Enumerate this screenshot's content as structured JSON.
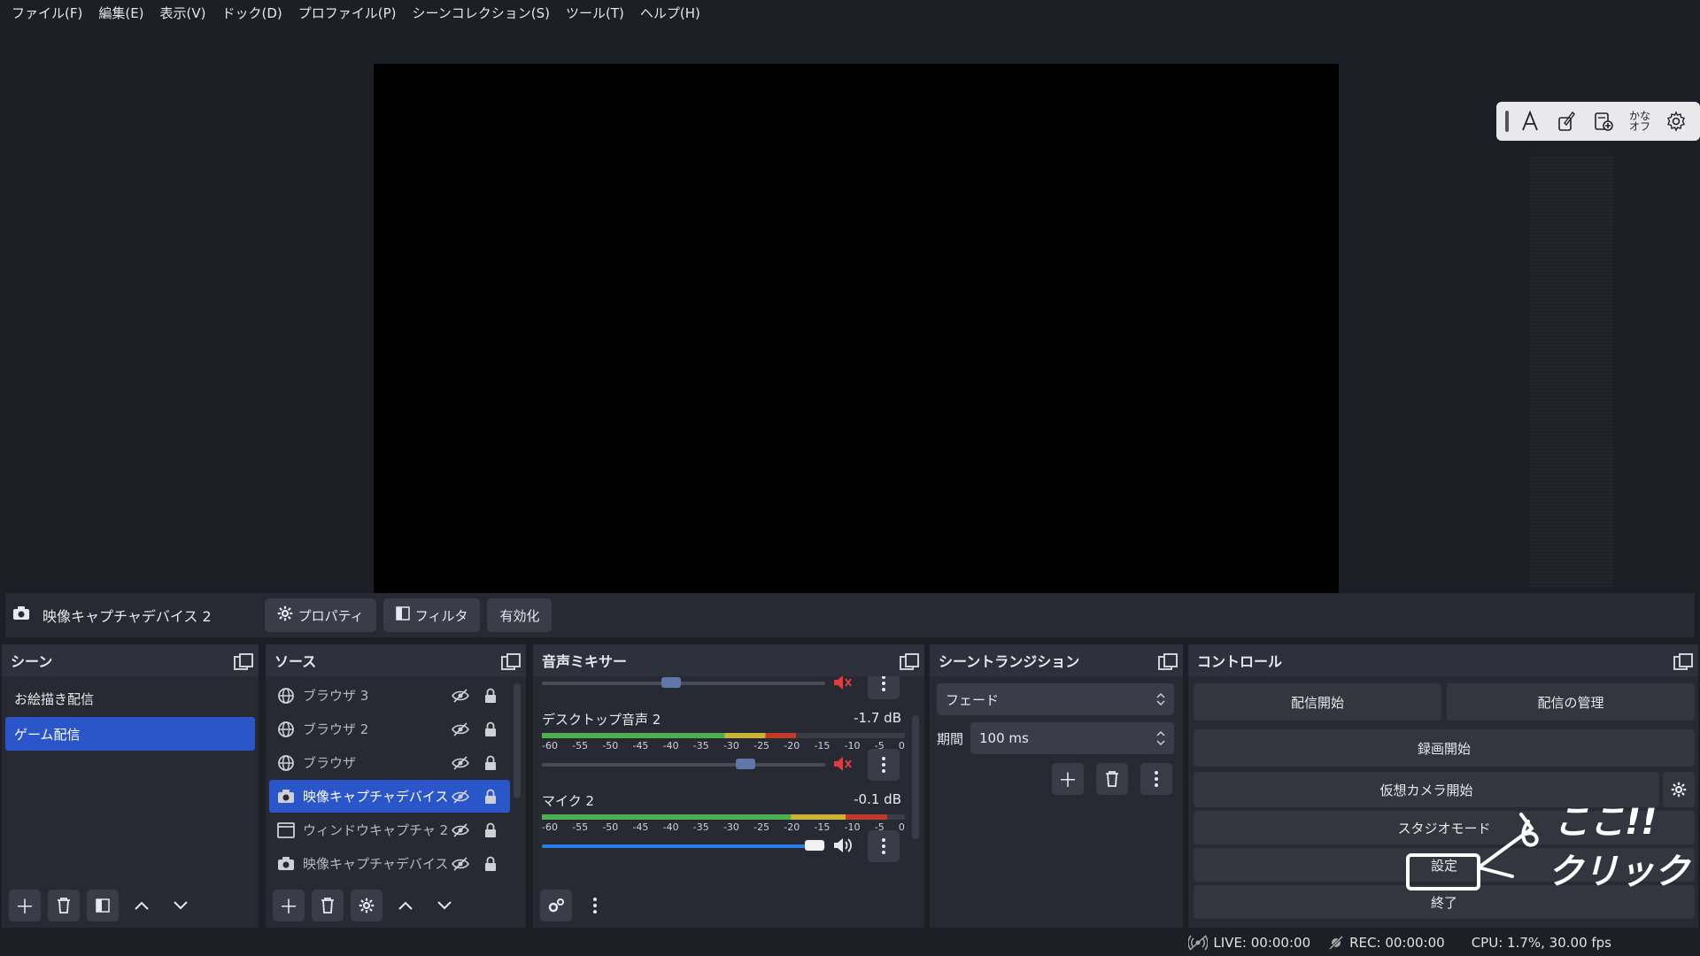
{
  "menu": [
    "ファイル(F)",
    "編集(E)",
    "表示(V)",
    "ドック(D)",
    "プロファイル(P)",
    "シーンコレクション(S)",
    "ツール(T)",
    "ヘルプ(H)"
  ],
  "ime": {
    "kana_top": "かな",
    "kana_bottom": "オフ"
  },
  "context": {
    "source_name": "映像キャプチャデバイス 2",
    "properties_label": "プロパティ",
    "filters_label": "フィルタ",
    "activate_label": "有効化"
  },
  "scenes": {
    "title": "シーン",
    "items": [
      "お絵描き配信",
      "ゲーム配信"
    ],
    "selected_index": 1
  },
  "sources": {
    "title": "ソース",
    "items": [
      {
        "name": "ブラウザ 3",
        "icon": "globe-icon"
      },
      {
        "name": "ブラウザ 2",
        "icon": "globe-icon"
      },
      {
        "name": "ブラウザ",
        "icon": "globe-icon"
      },
      {
        "name": "映像キャプチャデバイス 2",
        "icon": "camera-icon"
      },
      {
        "name": "ウィンドウキャプチャ 2",
        "icon": "window-icon"
      },
      {
        "name": "映像キャプチャデバイス",
        "icon": "camera-icon"
      }
    ],
    "selected_index": 3
  },
  "mixer": {
    "title": "音声ミキサー",
    "ticks": [
      "-60",
      "-55",
      "-50",
      "-45",
      "-40",
      "-35",
      "-30",
      "-25",
      "-20",
      "-15",
      "-10",
      "-5",
      "0"
    ],
    "channels": [
      {
        "name": "",
        "db": "",
        "muted": true,
        "volume": 0.45
      },
      {
        "name": "デスクトップ音声 2",
        "db": "-1.7 dB",
        "muted": true,
        "volume": 0.73
      },
      {
        "name": "マイク 2",
        "db": "-0.1 dB",
        "muted": false,
        "volume": 0.99
      }
    ]
  },
  "transitions": {
    "title": "シーントランジション",
    "selected": "フェード",
    "duration_label": "期間",
    "duration_value": "100 ms"
  },
  "controls": {
    "title": "コントロール",
    "start_streaming": "配信開始",
    "manage_broadcast": "配信の管理",
    "start_recording": "録画開始",
    "start_virtual_cam": "仮想カメラ開始",
    "studio_mode": "スタジオモード",
    "settings": "設定",
    "exit": "終了"
  },
  "status": {
    "live": "LIVE: 00:00:00",
    "rec": "REC: 00:00:00",
    "cpu": "CPU: 1.7%, 30.00 fps"
  },
  "annotation_text": "ここ!! クリック",
  "colors": {
    "accent": "#2b56c9",
    "mute_red": "#e23b3b",
    "meter_green": "#4caf50",
    "meter_yellow": "#c9b437",
    "meter_red": "#c0392b"
  }
}
